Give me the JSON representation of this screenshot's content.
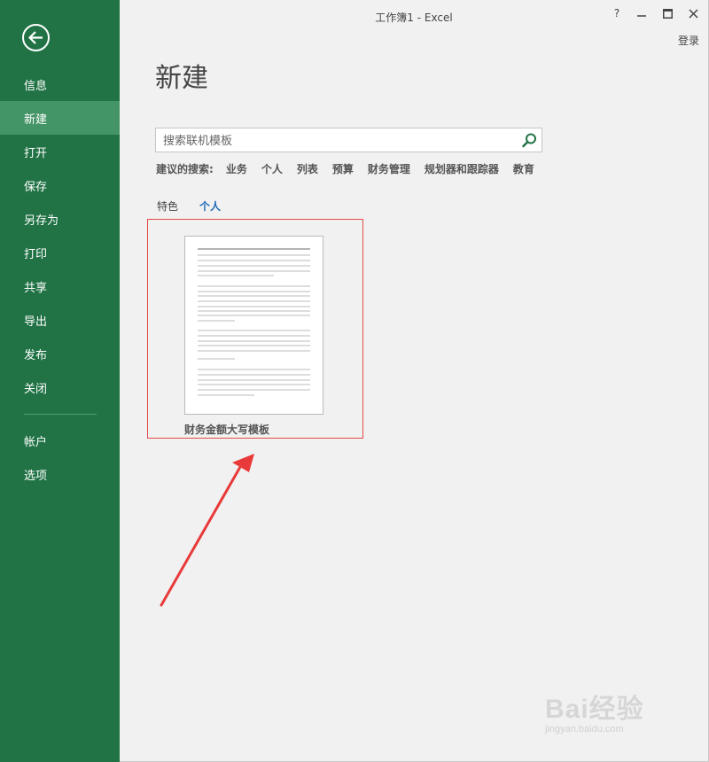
{
  "window": {
    "title": "工作簿1 - Excel",
    "help_label": "?",
    "minimize_label": "—",
    "maximize_label": "☐",
    "close_label": "✕",
    "signin_label": "登录"
  },
  "sidebar": {
    "back_icon": "back-arrow-icon",
    "items": [
      {
        "label": "信息"
      },
      {
        "label": "新建",
        "active": true
      },
      {
        "label": "打开"
      },
      {
        "label": "保存"
      },
      {
        "label": "另存为"
      },
      {
        "label": "打印"
      },
      {
        "label": "共享"
      },
      {
        "label": "导出"
      },
      {
        "label": "发布"
      },
      {
        "label": "关闭"
      }
    ],
    "bottom_items": [
      {
        "label": "帐户"
      },
      {
        "label": "选项"
      }
    ]
  },
  "main": {
    "title": "新建",
    "search": {
      "placeholder": "搜索联机模板",
      "value": "",
      "icon": "search-icon"
    },
    "suggested": {
      "label": "建议的搜索:",
      "links": [
        "业务",
        "个人",
        "列表",
        "预算",
        "财务管理",
        "规划器和跟踪器",
        "教育"
      ]
    },
    "tabs": [
      {
        "label": "特色"
      },
      {
        "label": "个人",
        "active": true
      }
    ],
    "templates": [
      {
        "name": "财务金额大写模板"
      }
    ]
  },
  "watermark": {
    "main": "Bai经验",
    "sub": "jingyan.baidu.com"
  },
  "colors": {
    "sidebar": "#217346",
    "sidebar_active": "#439467",
    "highlight_box": "#e34a4a",
    "arrow": "#e83a3a",
    "active_tab": "#1e6bb8"
  }
}
